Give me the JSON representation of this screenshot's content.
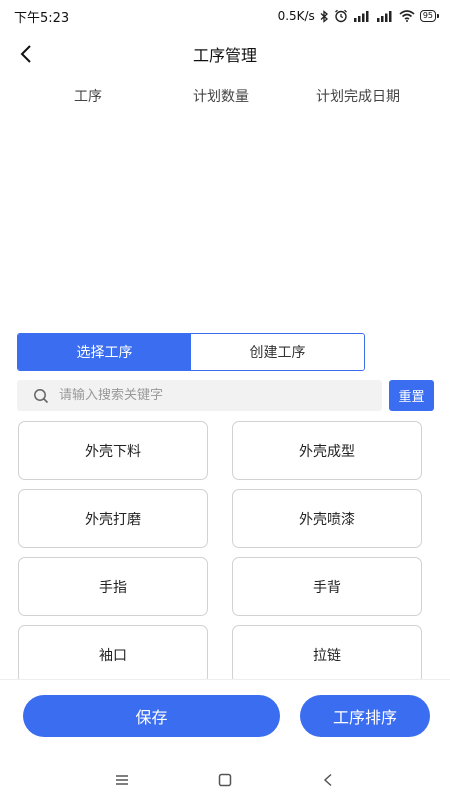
{
  "status_bar": {
    "time": "下午5:23",
    "network_speed": "0.5K/s",
    "battery_level": "95"
  },
  "header": {
    "title": "工序管理"
  },
  "table": {
    "columns": [
      "工序",
      "计划数量",
      "计划完成日期"
    ]
  },
  "segment": {
    "tabs": [
      {
        "label": "选择工序",
        "active": true
      },
      {
        "label": "创建工序",
        "active": false
      }
    ]
  },
  "search": {
    "placeholder": "请输入搜索关键字",
    "value": "",
    "reset_label": "重置"
  },
  "processes": [
    {
      "label": "外壳下料"
    },
    {
      "label": "外壳成型"
    },
    {
      "label": "外壳打磨"
    },
    {
      "label": "外壳喷漆"
    },
    {
      "label": "手指"
    },
    {
      "label": "手背"
    },
    {
      "label": "袖口"
    },
    {
      "label": "拉链"
    }
  ],
  "footer": {
    "save_label": "保存",
    "sort_label": "工序排序"
  },
  "colors": {
    "accent": "#3a6df0",
    "tile_border": "#d2d2d2",
    "search_bg": "#f2f2f2"
  }
}
